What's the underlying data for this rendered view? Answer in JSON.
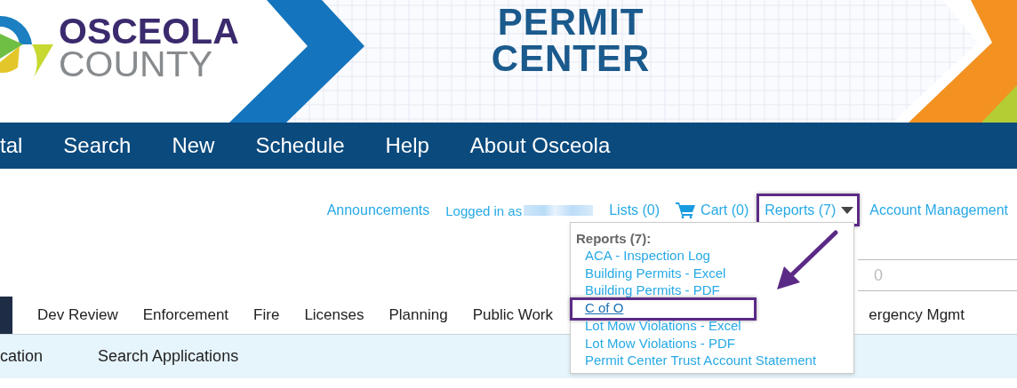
{
  "banner": {
    "logo_line_1": "OSCEOLA",
    "logo_line_2": "COUNTY",
    "title_line_1": "PERMIT",
    "title_line_2": "CENTER"
  },
  "nav": {
    "items": [
      {
        "label": "tal"
      },
      {
        "label": "Search"
      },
      {
        "label": "New"
      },
      {
        "label": "Schedule"
      },
      {
        "label": "Help"
      },
      {
        "label": "About Osceola"
      }
    ]
  },
  "top_links": [
    {
      "kind": "link",
      "label": "Announcements",
      "annotated": false
    },
    {
      "kind": "user",
      "label": "Logged in as",
      "annotated": false
    },
    {
      "kind": "link",
      "label": "Lists (0)",
      "annotated": false
    },
    {
      "kind": "cart",
      "label": "Cart (0)",
      "annotated": false
    },
    {
      "kind": "menu",
      "label": "Reports (7)",
      "expanded": true,
      "annotated": true
    },
    {
      "kind": "link",
      "label": "Account Management",
      "annotated": false
    }
  ],
  "reports_menu": {
    "title": "Reports (7):",
    "items": [
      {
        "label": "ACA - Inspection Log",
        "hovered": false,
        "annotated": false
      },
      {
        "label": "Building Permits - Excel",
        "hovered": false,
        "annotated": false
      },
      {
        "label": "Building Permits - PDF",
        "hovered": false,
        "annotated": false
      },
      {
        "label": "C of O",
        "hovered": true,
        "annotated": true
      },
      {
        "label": "Lot Mow Violations - Excel",
        "hovered": false,
        "annotated": false
      },
      {
        "label": "Lot Mow Violations - PDF",
        "hovered": false,
        "annotated": false
      },
      {
        "label": "Permit Center Trust Account Statement",
        "hovered": false,
        "annotated": false
      }
    ]
  },
  "search_field": {
    "placeholder": "0"
  },
  "module_tabs": [
    {
      "selected": true
    },
    {
      "label": "Dev Review",
      "selected": false
    },
    {
      "label": "Enforcement",
      "selected": false
    },
    {
      "label": "Fire",
      "selected": false
    },
    {
      "label": "Licenses",
      "selected": false
    },
    {
      "label": "Planning",
      "selected": false
    },
    {
      "label": "Public Work",
      "selected": false
    },
    {
      "label": "ergency Mgmt",
      "selected": false
    }
  ],
  "sub_tabs": [
    {
      "label": "cation"
    },
    {
      "label": "Search Applications"
    }
  ]
}
